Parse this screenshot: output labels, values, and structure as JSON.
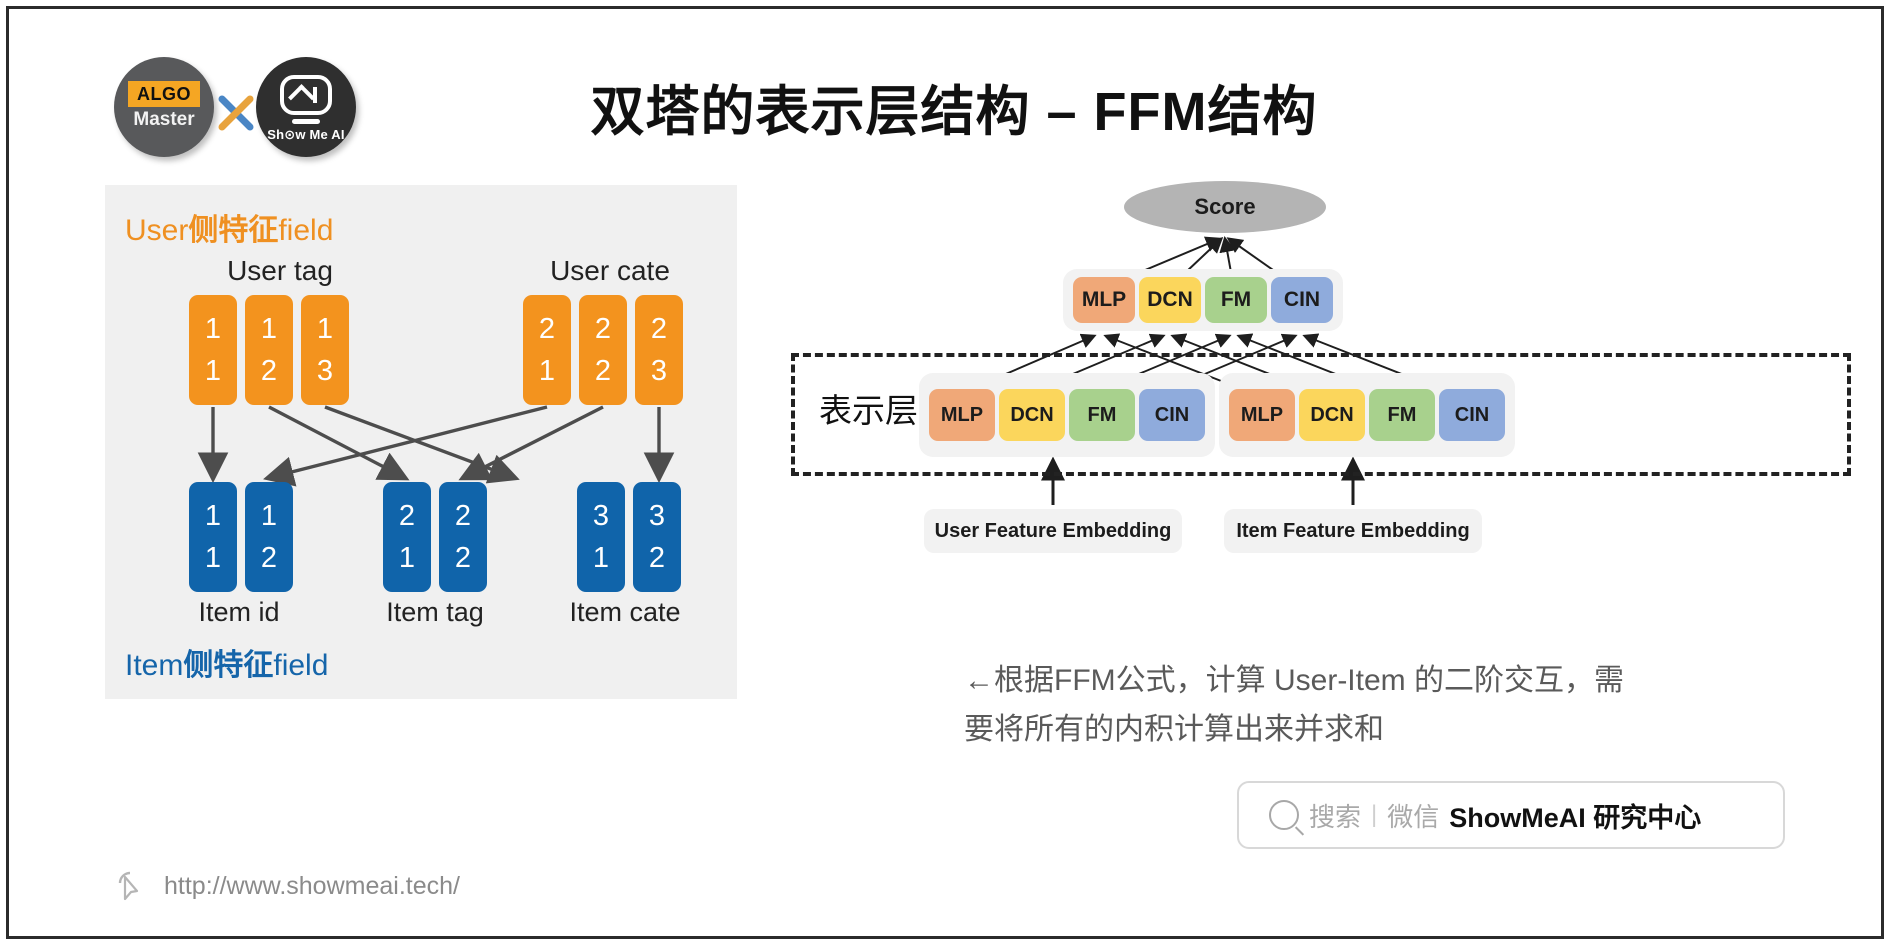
{
  "header": {
    "logo_algo_tag": "ALGO",
    "logo_algo_sub": "Master",
    "logo_x": "X",
    "logo_show_brand": "Sh⊙w Me AI",
    "title": "双塔的表示层结构 – FFM结构"
  },
  "left_panel": {
    "user_field_label_prefix": "User",
    "user_field_label_mid": "侧特征",
    "user_field_label_suffix": "field",
    "item_field_label_prefix": "Item",
    "item_field_label_mid": "侧特征",
    "item_field_label_suffix": "field",
    "user_groups": [
      {
        "title": "User tag",
        "cells": [
          {
            "top": "1",
            "bottom": "1"
          },
          {
            "top": "1",
            "bottom": "2"
          },
          {
            "top": "1",
            "bottom": "3"
          }
        ]
      },
      {
        "title": "User cate",
        "cells": [
          {
            "top": "2",
            "bottom": "1"
          },
          {
            "top": "2",
            "bottom": "2"
          },
          {
            "top": "2",
            "bottom": "3"
          }
        ]
      }
    ],
    "item_groups": [
      {
        "title": "Item id",
        "cells": [
          {
            "top": "1",
            "bottom": "1"
          },
          {
            "top": "1",
            "bottom": "2"
          }
        ]
      },
      {
        "title": "Item tag",
        "cells": [
          {
            "top": "2",
            "bottom": "1"
          },
          {
            "top": "2",
            "bottom": "2"
          }
        ]
      },
      {
        "title": "Item cate",
        "cells": [
          {
            "top": "3",
            "bottom": "1"
          },
          {
            "top": "3",
            "bottom": "2"
          }
        ]
      }
    ]
  },
  "right_panel": {
    "score_label": "Score",
    "repr_layer_label": "表示层",
    "top_modules": [
      "MLP",
      "DCN",
      "FM",
      "CIN"
    ],
    "user_modules": [
      "MLP",
      "DCN",
      "FM",
      "CIN"
    ],
    "item_modules": [
      "MLP",
      "DCN",
      "FM",
      "CIN"
    ],
    "user_embedding_label": "User Feature Embedding",
    "item_embedding_label": "Item Feature Embedding"
  },
  "caption": {
    "line1": "←根据FFM公式，计算 User-Item 的二阶交互，需",
    "line2": "要将所有的内积计算出来并求和"
  },
  "search": {
    "hint": "搜索",
    "divider": "|",
    "channel": "微信",
    "brand": "ShowMeAI 研究中心"
  },
  "footer": {
    "url": "http://www.showmeai.tech/"
  },
  "colors": {
    "orange": "#f3931e",
    "blue": "#1064aa",
    "mlp": "#f0a878",
    "dcn": "#fbd65c",
    "fm": "#a8d18d",
    "cin": "#8fabdc",
    "panel_bg": "#f0f0f0",
    "score": "#b4b4b4"
  }
}
